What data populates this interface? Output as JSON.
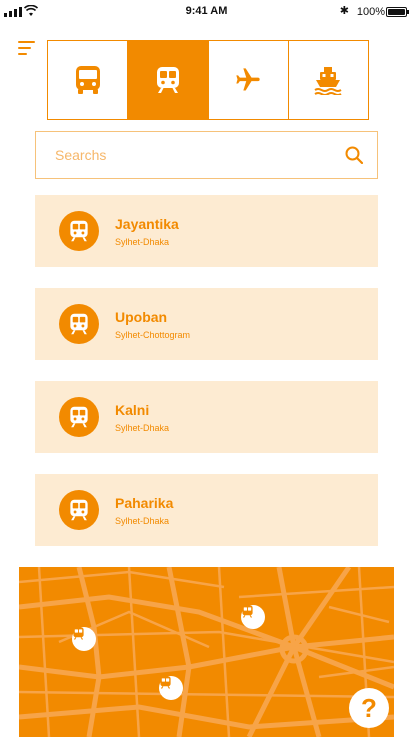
{
  "status": {
    "time": "9:41 AM",
    "battery": "100%"
  },
  "colors": {
    "accent": "#f28a00",
    "card_bg": "#fdebd2",
    "map_road": "#f7a448"
  },
  "modes": [
    {
      "icon": "bus-icon",
      "active": false
    },
    {
      "icon": "train-icon",
      "active": true
    },
    {
      "icon": "airplane-icon",
      "active": false
    },
    {
      "icon": "ship-icon",
      "active": false
    }
  ],
  "search": {
    "placeholder": "Searchs",
    "value": ""
  },
  "routes": [
    {
      "name": "Jayantika",
      "route": "Sylhet-Dhaka",
      "icon": "train-icon"
    },
    {
      "name": "Upoban",
      "route": "Sylhet-Chottogram",
      "icon": "train-icon"
    },
    {
      "name": "Kalni",
      "route": "Sylhet-Dhaka",
      "icon": "train-icon"
    },
    {
      "name": "Paharika",
      "route": "Sylhet-Dhaka",
      "icon": "train-icon"
    }
  ],
  "map": {
    "pins": [
      "train-pin",
      "train-pin",
      "train-pin"
    ],
    "help_label": "?"
  }
}
